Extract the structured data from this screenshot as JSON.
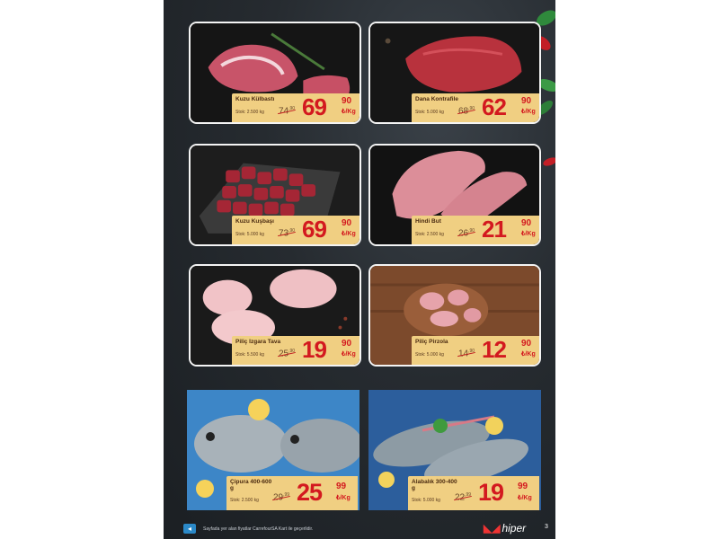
{
  "products": [
    {
      "name": "Kuzu Külbastı",
      "stock": "Stok: 2.500 kg",
      "old_whole": "74",
      "old_dec": ",90",
      "price_whole": "69",
      "price_dec": "90",
      "unit": "₺/Kg",
      "colors": {
        "meat": "#c4546a",
        "bg": "#1a1a1a"
      }
    },
    {
      "name": "Dana Kontrafile",
      "stock": "Stok: 5.000 kg",
      "old_whole": "68",
      "old_dec": ",90",
      "price_whole": "62",
      "price_dec": "90",
      "unit": "₺/Kg",
      "colors": {
        "meat": "#b9303c",
        "bg": "#1a1a1a"
      }
    },
    {
      "name": "Kuzu Kuşbaşı",
      "stock": "Stok: 5.000 kg",
      "old_whole": "73",
      "old_dec": ",90",
      "price_whole": "69",
      "price_dec": "90",
      "unit": "₺/Kg",
      "colors": {
        "meat": "#a62433",
        "bg": "#2a2a2a"
      }
    },
    {
      "name": "Hindi But",
      "stock": "Stok: 2.500 kg",
      "old_whole": "26",
      "old_dec": ",90",
      "price_whole": "21",
      "price_dec": "90",
      "unit": "₺/Kg",
      "colors": {
        "meat": "#d98a96",
        "bg": "#141414"
      }
    },
    {
      "name": "Piliç Izgara Tava",
      "stock": "Stok: 5.500 kg",
      "old_whole": "25",
      "old_dec": ",90",
      "price_whole": "19",
      "price_dec": "90",
      "unit": "₺/Kg",
      "colors": {
        "meat": "#f1c4c8",
        "bg": "#1c1c1c"
      }
    },
    {
      "name": "Piliç Pirzola",
      "stock": "Stok: 5.000 kg",
      "old_whole": "14",
      "old_dec": ",90",
      "price_whole": "12",
      "price_dec": "90",
      "unit": "₺/Kg",
      "colors": {
        "meat": "#e7a7ae",
        "bg": "#7a4a2c"
      }
    },
    {
      "name": "Çipura 400-600 g",
      "stock": "Stok: 2.500 kg",
      "old_whole": "29",
      "old_dec": ",99",
      "price_whole": "25",
      "price_dec": "99",
      "unit": "₺/Kg",
      "colors": {
        "meat": "#9aa5ae",
        "bg": "#3f86c8"
      }
    },
    {
      "name": "Alabalık 300-400 g",
      "stock": "Stok: 5.000 kg",
      "old_whole": "22",
      "old_dec": ",99",
      "price_whole": "19",
      "price_dec": "99",
      "unit": "₺/Kg",
      "colors": {
        "meat": "#8c9aa3",
        "bg": "#2b5c9a"
      }
    }
  ],
  "footer": {
    "note": "Sayfada yer alan fiyatlar CarrefourSA Kart ile geçerlidir.",
    "brand": "hiper",
    "page_number": "3"
  }
}
